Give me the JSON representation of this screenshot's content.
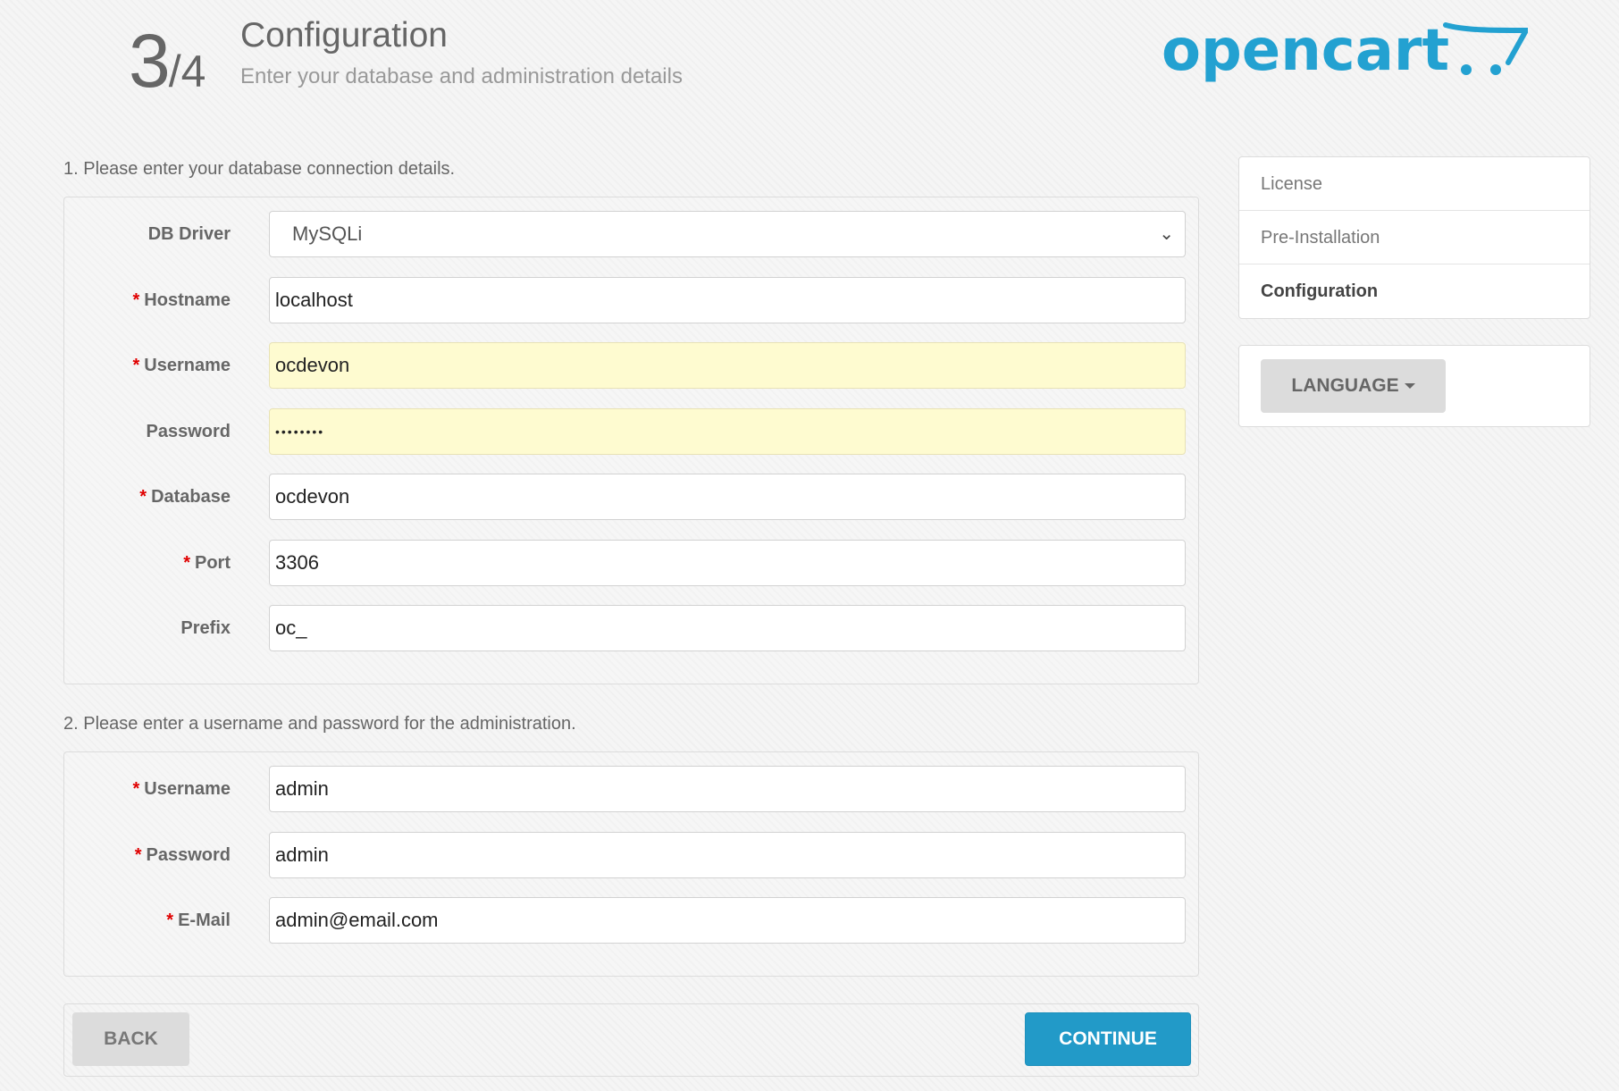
{
  "header": {
    "step_current": "3",
    "step_total": "/4",
    "title": "Configuration",
    "subtitle": "Enter your database and administration details",
    "logo_text": "opencart",
    "logo_color": "#23a1d1"
  },
  "db": {
    "heading": "1. Please enter your database connection details.",
    "fields": [
      {
        "label": "DB Driver",
        "required": false,
        "value": "MySQLi",
        "type": "select"
      },
      {
        "label": "Hostname",
        "required": true,
        "value": "localhost",
        "type": "text"
      },
      {
        "label": "Username",
        "required": true,
        "value": "ocdevon",
        "type": "text"
      },
      {
        "label": "Password",
        "required": false,
        "value": "••••••••",
        "type": "password"
      },
      {
        "label": "Database",
        "required": true,
        "value": "ocdevon",
        "type": "text"
      },
      {
        "label": "Port",
        "required": true,
        "value": "3306",
        "type": "text"
      },
      {
        "label": "Prefix",
        "required": false,
        "value": "oc_",
        "type": "text"
      }
    ]
  },
  "admin": {
    "heading": "2. Please enter a username and password for the administration.",
    "fields": [
      {
        "label": "Username",
        "required": true,
        "value": "admin",
        "type": "text"
      },
      {
        "label": "Password",
        "required": true,
        "value": "admin",
        "type": "text"
      },
      {
        "label": "E-Mail",
        "required": true,
        "value": "admin@email.com",
        "type": "text"
      }
    ]
  },
  "required_marker": "*",
  "sidebar": {
    "items": [
      {
        "label": "License"
      },
      {
        "label": "Pre-Installation"
      },
      {
        "label": "Configuration"
      }
    ]
  },
  "language": {
    "label": "LANGUAGE"
  },
  "buttons": {
    "back": "BACK",
    "continue": "CONTINUE"
  },
  "colors": {
    "accent": "#229ac8",
    "required": "#e00000",
    "autofill": "#fefbd0"
  }
}
